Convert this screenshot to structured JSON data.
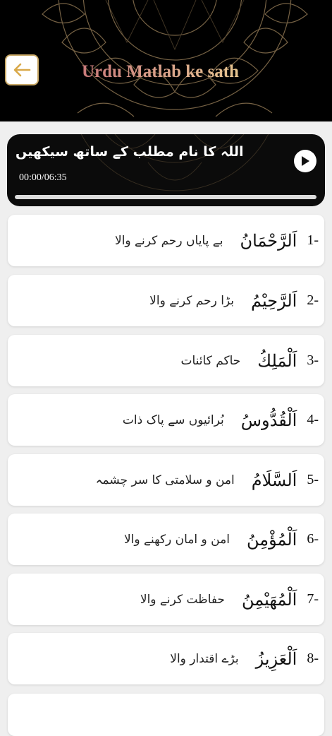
{
  "header": {
    "title": "Urdu Matlab ke sath"
  },
  "player": {
    "title": "اللہ کا نام مطلب کے ساتھ سیکھیں",
    "time": "00:00/06:35",
    "progress": 0
  },
  "names": [
    {
      "number": "1-",
      "arabic": "اَلرَّحْمَانُ",
      "urdu": "بے پایاں رحم کرنے والا"
    },
    {
      "number": "2-",
      "arabic": "اَلرَّحِيْمُ",
      "urdu": "بڑا رحم کرنے والا"
    },
    {
      "number": "3-",
      "arabic": "اَلْمَلِكُ",
      "urdu": "حاکم کائنات"
    },
    {
      "number": "4-",
      "arabic": "اَلْقُدُّوسُ",
      "urdu": "بُرائیوں سے پاک ذات"
    },
    {
      "number": "5-",
      "arabic": "اَلسَّلَامُ",
      "urdu": "امن و سلامتی کا سر چشمہ"
    },
    {
      "number": "6-",
      "arabic": "اَلْمُؤْمِنُ",
      "urdu": "امن و امان رکھنے والا"
    },
    {
      "number": "7-",
      "arabic": "اَلْمُهَيْمِنُ",
      "urdu": "حفاظت کرنے والا"
    },
    {
      "number": "8-",
      "arabic": "اَلْعَزِيزُ",
      "urdu": "بڑے اقتدار والا"
    }
  ],
  "icons": {
    "back": "arrow-left-icon",
    "play": "play-icon"
  },
  "colors": {
    "accent_gold": "#c9a866",
    "header_bg": "#000000"
  }
}
